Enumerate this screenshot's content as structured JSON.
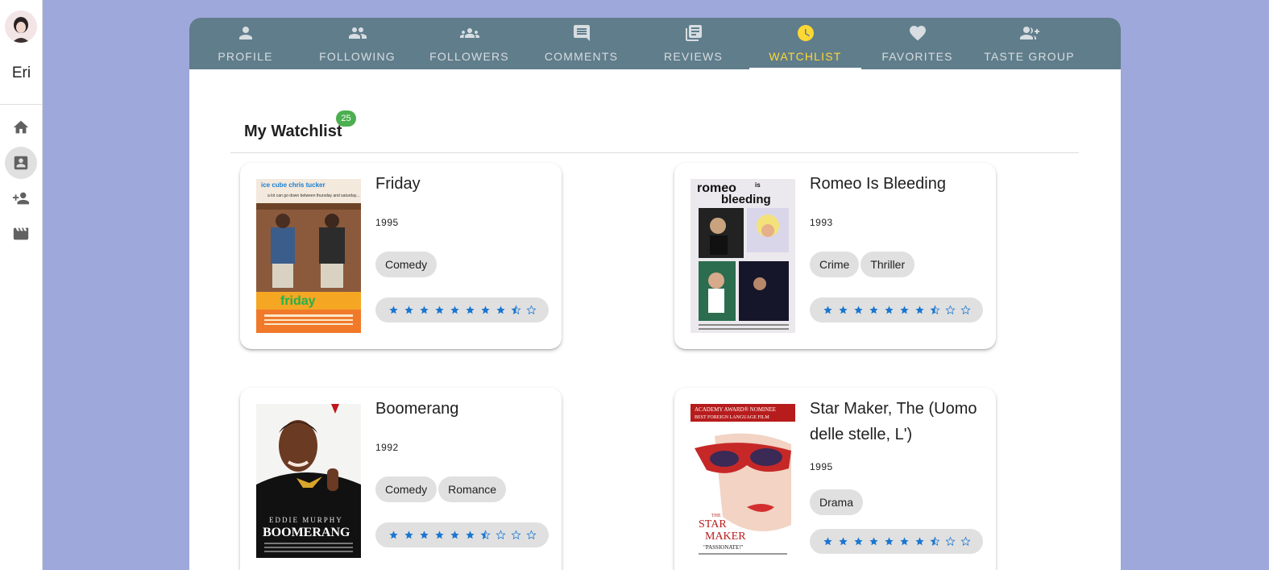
{
  "rail": {
    "user_name": "Eri",
    "items": [
      {
        "icon": "home-icon"
      },
      {
        "icon": "contact-card-icon",
        "active": true
      },
      {
        "icon": "person-add-icon"
      },
      {
        "icon": "movie-icon"
      }
    ]
  },
  "tabs": [
    {
      "label": "Profile",
      "icon": "person-icon"
    },
    {
      "label": "Following",
      "icon": "people-icon"
    },
    {
      "label": "Followers",
      "icon": "groups-icon"
    },
    {
      "label": "Comments",
      "icon": "comment-icon"
    },
    {
      "label": "Reviews",
      "icon": "library-books-icon"
    },
    {
      "label": "Watchlist",
      "icon": "clock-icon",
      "active": true
    },
    {
      "label": "Favorites",
      "icon": "heart-icon"
    },
    {
      "label": "Taste Group",
      "icon": "group-add-icon"
    }
  ],
  "watchlist": {
    "title": "My Watchlist",
    "count": "25"
  },
  "movies": [
    {
      "title": "Friday",
      "year": "1995",
      "genres": [
        "Comedy"
      ],
      "rating": 8.5,
      "max_rating": 10
    },
    {
      "title": "Romeo Is Bleeding",
      "year": "1993",
      "genres": [
        "Crime",
        "Thriller"
      ],
      "rating": 7.5,
      "max_rating": 10
    },
    {
      "title": "Boomerang",
      "year": "1992",
      "genres": [
        "Comedy",
        "Romance"
      ],
      "rating": 6.5,
      "max_rating": 10
    },
    {
      "title": "Star Maker, The (Uomo delle stelle, L')",
      "year": "1995",
      "genres": [
        "Drama"
      ],
      "rating": 7.5,
      "max_rating": 10
    }
  ],
  "posters": {
    "friday": {
      "top_text": "ice cube   chris tucker",
      "tagline": "a lot can go down between thursday and saturday...",
      "logo": "friday"
    },
    "romeo": {
      "logo_top": "romeo",
      "logo_mid": "is",
      "logo_bottom": "bleeding"
    },
    "boomerang": {
      "actor": "EDDIE MURPHY",
      "logo": "BOOMERANG"
    },
    "starmaker": {
      "banner_1": "ACADEMY AWARD® NOMINEE",
      "banner_2": "BEST FOREIGN LANGUAGE FILM",
      "logo_1": "THE",
      "logo_2": "STAR",
      "logo_3": "MAKER",
      "quote": "\"PASSIONATE!\""
    }
  },
  "colors": {
    "accent_active_tab": "#fdd835",
    "tabbar": "#607d8b",
    "badge": "#4caf50",
    "star": "#1976d2",
    "background": "#9ea8db"
  }
}
